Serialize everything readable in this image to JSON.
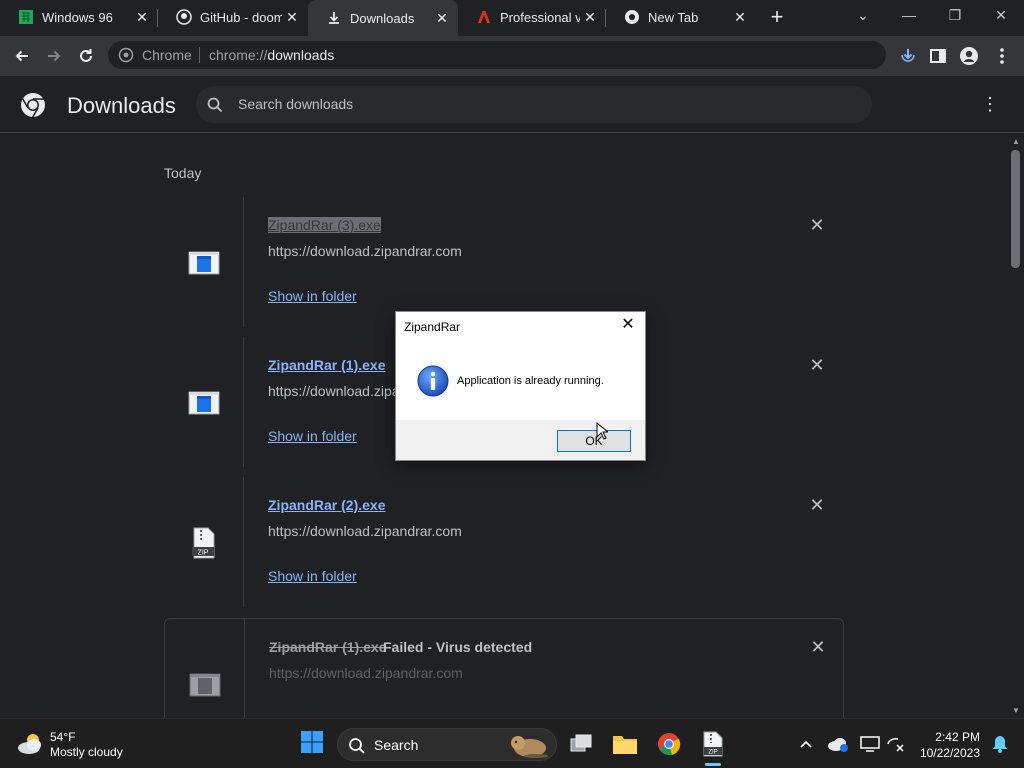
{
  "tabs": [
    {
      "title": "Windows 96",
      "favicon": "windows96-icon"
    },
    {
      "title": "GitHub - doom",
      "favicon": "github-icon"
    },
    {
      "title": "Downloads",
      "favicon": "download-icon"
    },
    {
      "title": "Professional vi",
      "favicon": "adobe-icon"
    },
    {
      "title": "New Tab",
      "favicon": "chrome-icon"
    }
  ],
  "toolbar": {
    "chip": "Chrome",
    "url_scheme": "chrome://",
    "url_host": "downloads"
  },
  "page": {
    "title": "Downloads",
    "search_placeholder": "Search downloads",
    "section_date": "Today"
  },
  "downloads": [
    {
      "name": "ZipandRar (3).exe",
      "source": "https://download.zipandrar.com",
      "action": "Show in folder",
      "icon": "exe-file-icon"
    },
    {
      "name": "ZipandRar (1).exe",
      "source": "https://download.zipandrar.com",
      "action": "Show in folder",
      "icon": "exe-file-icon"
    },
    {
      "name": "ZipandRar (2).exe",
      "source": "https://download.zipandrar.com",
      "action": "Show in folder",
      "icon": "zip-file-icon"
    },
    {
      "name": "ZipandRar (1).exe",
      "status": "Failed - Virus detected",
      "source": "https://download.zipandrar.com",
      "icon": "exe-file-icon"
    }
  ],
  "dialog": {
    "title": "ZipandRar",
    "message": "Application is already running.",
    "ok_label": "OK"
  },
  "taskbar": {
    "weather_temp": "54°F",
    "weather_desc": "Mostly cloudy",
    "search_label": "Search",
    "time": "2:42 PM",
    "date": "10/22/2023"
  },
  "colors": {
    "page_bg": "#202124",
    "link": "#8ab4f8",
    "accent": "#0078d7"
  }
}
